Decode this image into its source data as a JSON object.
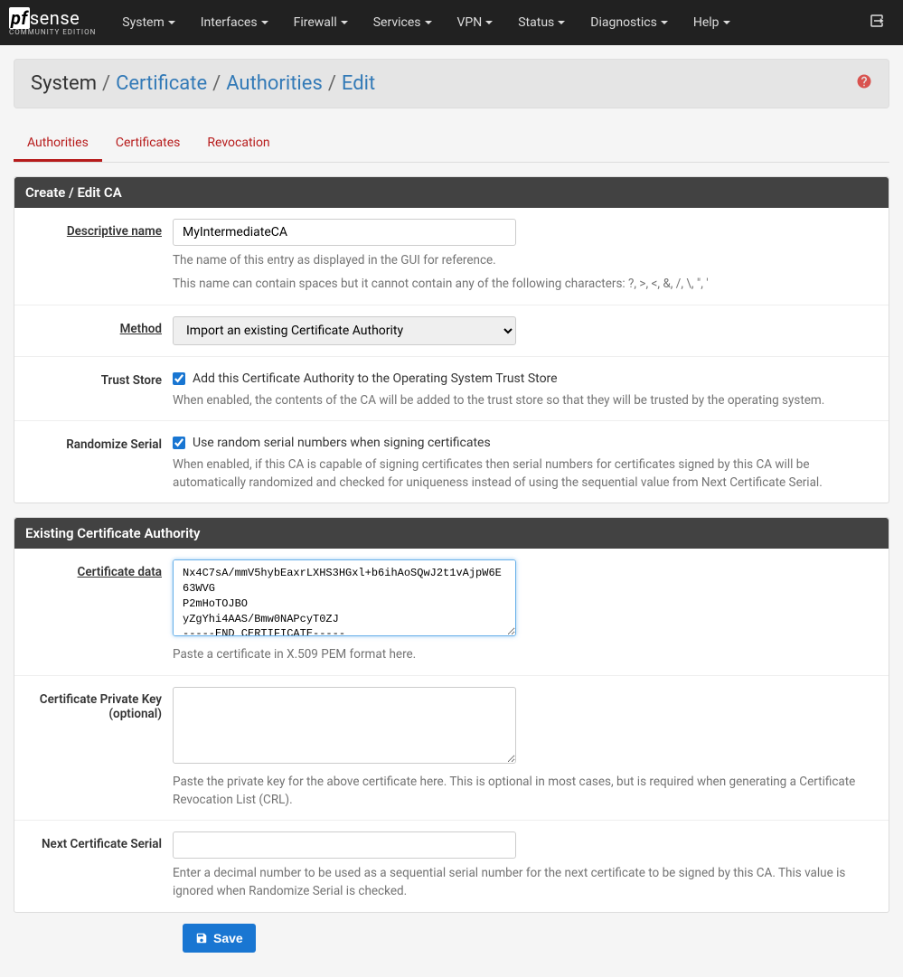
{
  "brand": {
    "main_pf": "pf",
    "main_sense": "sense",
    "sub": "COMMUNITY EDITION"
  },
  "nav": {
    "items": [
      "System",
      "Interfaces",
      "Firewall",
      "Services",
      "VPN",
      "Status",
      "Diagnostics",
      "Help"
    ]
  },
  "breadcrumb": {
    "root": "System",
    "parts": [
      "Certificate",
      "Authorities",
      "Edit"
    ]
  },
  "tabs": [
    "Authorities",
    "Certificates",
    "Revocation"
  ],
  "panel1": {
    "title": "Create / Edit CA"
  },
  "form": {
    "descr_label": "Descriptive name",
    "descr_value": "MyIntermediateCA",
    "descr_help1": "The name of this entry as displayed in the GUI for reference.",
    "descr_help2": "This name can contain spaces but it cannot contain any of the following characters: ?, >, <, &, /, \\, \", '",
    "method_label": "Method",
    "method_value": "Import an existing Certificate Authority",
    "trust_label": "Trust Store",
    "trust_cb": "Add this Certificate Authority to the Operating System Trust Store",
    "trust_help": "When enabled, the contents of the CA will be added to the trust store so that they will be trusted by the operating system.",
    "rand_label": "Randomize Serial",
    "rand_cb": "Use random serial numbers when signing certificates",
    "rand_help": "When enabled, if this CA is capable of signing certificates then serial numbers for certificates signed by this CA will be automatically randomized and checked for uniqueness instead of using the sequential value from Next Certificate Serial."
  },
  "panel2": {
    "title": "Existing Certificate Authority"
  },
  "form2": {
    "cert_label": "Certificate data",
    "cert_value": "Nx4C7sA/mmV5hybEaxrLXHS3HGxl+b6ihAoSQwJ2t1vAjpW6E63WVG\nP2mHoTOJBO\nyZgYhi4AAS/Bmw0NAPcyT0ZJ\n-----END CERTIFICATE-----\n",
    "cert_help": "Paste a certificate in X.509 PEM format here.",
    "key_label": "Certificate Private Key (optional)",
    "key_value": "",
    "key_help": "Paste the private key for the above certificate here. This is optional in most cases, but is required when generating a Certificate Revocation List (CRL).",
    "serial_label": "Next Certificate Serial",
    "serial_value": "",
    "serial_help": "Enter a decimal number to be used as a sequential serial number for the next certificate to be signed by this CA. This value is ignored when Randomize Serial is checked."
  },
  "buttons": {
    "save": "Save"
  }
}
